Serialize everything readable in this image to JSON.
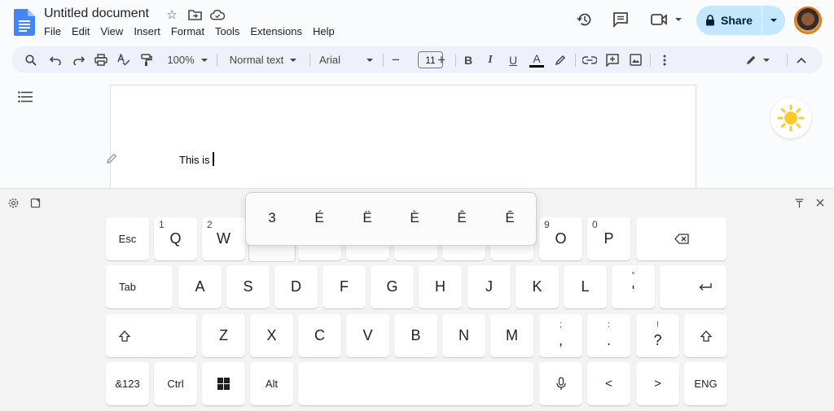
{
  "header": {
    "title": "Untitled document",
    "menu": [
      "File",
      "Edit",
      "View",
      "Insert",
      "Format",
      "Tools",
      "Extensions",
      "Help"
    ],
    "share_label": "Share",
    "icons": [
      "star-icon",
      "move-folder-icon",
      "cloud-saved-icon",
      "history-icon",
      "comment-icon",
      "meet-icon"
    ]
  },
  "toolbar": {
    "zoom": "100%",
    "style": "Normal text",
    "font": "Arial",
    "font_size": "11",
    "minus": "−",
    "plus": "+",
    "bold": "B",
    "italic": "I",
    "underline": "U",
    "text_color_label": "A"
  },
  "document": {
    "text": "This is"
  },
  "keyboard": {
    "popup_chars": [
      "3",
      "É",
      "Ë",
      "È",
      "Ê",
      "Ē"
    ],
    "row1": {
      "esc": "Esc",
      "keys": [
        {
          "label": "Q",
          "hint": "1"
        },
        {
          "label": "W",
          "hint": "2"
        },
        {
          "label": "O",
          "hint": "9"
        },
        {
          "label": "P",
          "hint": "0"
        }
      ]
    },
    "row2": {
      "tab": "Tab",
      "keys": [
        "A",
        "S",
        "D",
        "F",
        "G",
        "H",
        "J",
        "K",
        "L"
      ],
      "quote_top": "°",
      "quote_bottom": "'"
    },
    "row3": {
      "keys": [
        "Z",
        "X",
        "C",
        "V",
        "B",
        "N",
        "M"
      ],
      "comma_top": ";",
      "comma_bottom": ",",
      "period_top": ":",
      "period_bottom": ".",
      "question_top": "!",
      "question_bottom": "?"
    },
    "row4": {
      "num": "&123",
      "ctrl": "Ctrl",
      "alt": "Alt",
      "lang": "ENG",
      "left": "<",
      "right": ">"
    }
  }
}
